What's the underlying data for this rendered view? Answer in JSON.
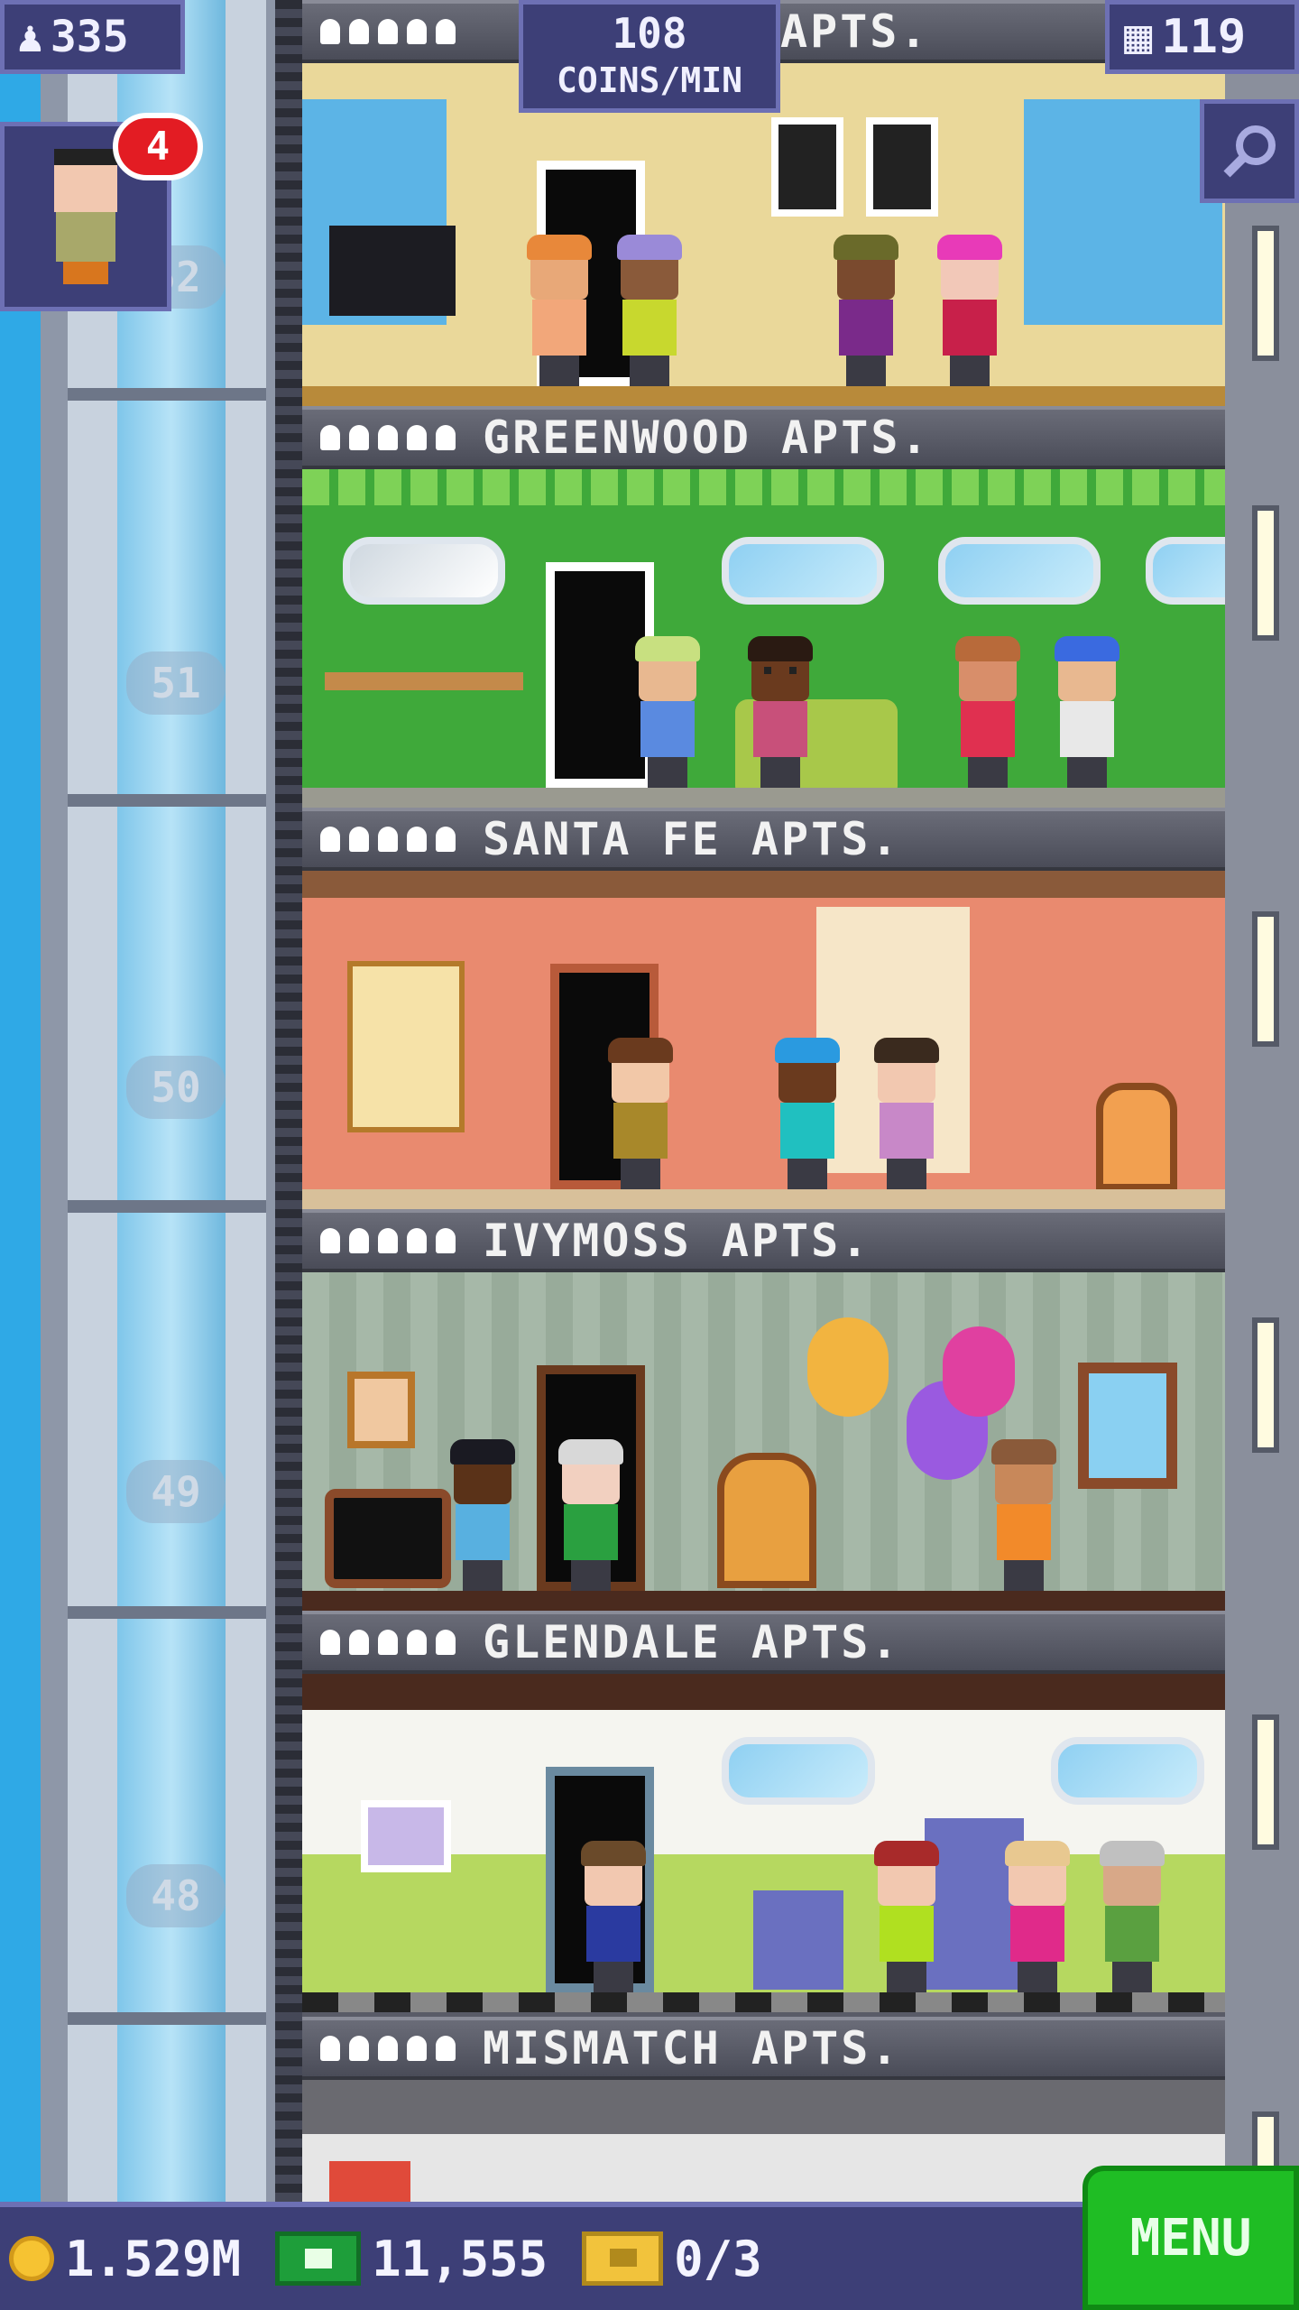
{
  "hud": {
    "population": "335",
    "coins_per_min_value": "108",
    "coins_per_min_label": "COINS/MIN",
    "floor_count": "119",
    "visitor_badge": "4"
  },
  "floors": [
    {
      "name": "APTS.",
      "number": "",
      "wall": "#ead89a"
    },
    {
      "name": "GREENWOOD APTS.",
      "number": "51",
      "wall": "#3fa93a"
    },
    {
      "name": "SANTA FE APTS.",
      "number": "50",
      "wall": "#e98a6f"
    },
    {
      "name": "IVYMOSS APTS.",
      "number": "49",
      "wall": "#a6b8a8"
    },
    {
      "name": "GLENDALE APTS.",
      "number": "48",
      "wall": "#f5f5f0"
    },
    {
      "name": "MISMATCH APTS.",
      "number": "",
      "wall": "#e6e6e6"
    }
  ],
  "top_floor_number": "52",
  "bottom_bar": {
    "coins": "1.529M",
    "tower_bux": "11,555",
    "tickets": "0/3",
    "menu_label": "MENU"
  },
  "colors": {
    "hud_bg": "#3d3f77",
    "hud_border": "#6d70b4",
    "menu_green": "#1fbd24",
    "badge_red": "#e31c23"
  },
  "icons": [
    "person-icon",
    "building-icon",
    "magnifier-icon",
    "coin-icon",
    "tower-bux-icon",
    "ticket-icon"
  ]
}
